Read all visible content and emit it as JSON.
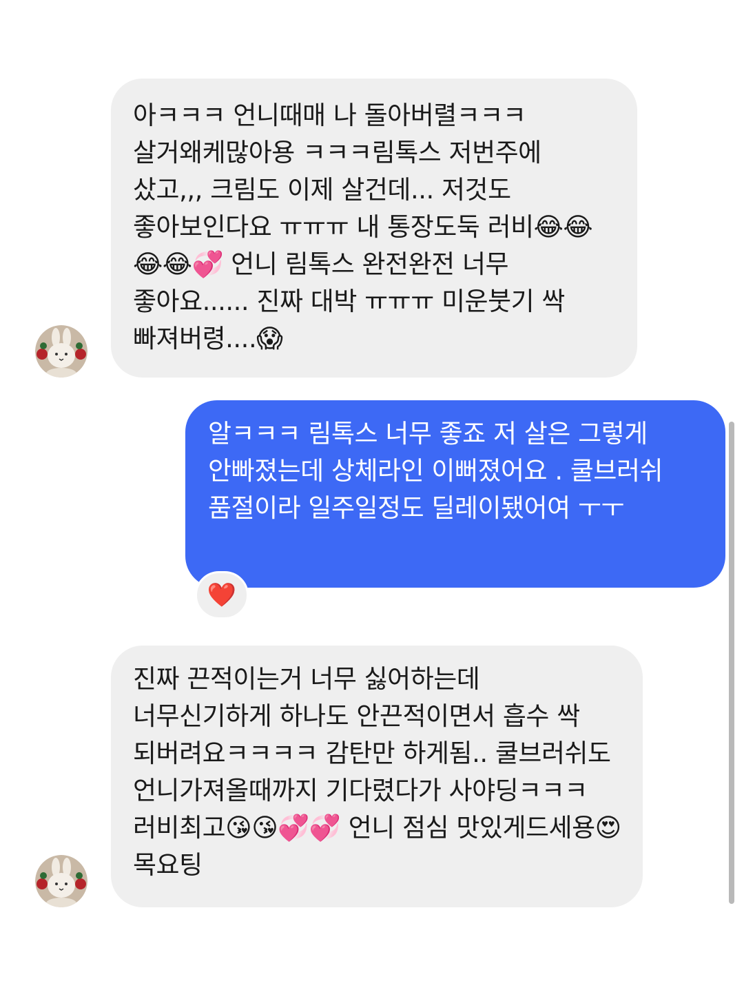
{
  "conversation": {
    "messages": [
      {
        "direction": "incoming",
        "text": "아ㅋㅋㅋ 언니때매 나 돌아버렬ㅋㅋㅋ 살거왜케많아용 ㅋㅋㅋ림톡스 저번주에 샀고,,, 크림도 이제 살건데... 저것도 좋아보인다요 ㅠㅠㅠ 내 통장도둑 러비😂😂😂😂💞 언니 림톡스 완전완전 너무 좋아요...... 진짜 대박 ㅠㅠㅠ 미운붓기 싹 빠져버령....😱"
      },
      {
        "direction": "outgoing",
        "text": "알ㅋㅋㅋ 림톡스 너무 좋죠 저 살은 그렇게 안빠졌는데 상체라인 이뻐졌어요 . 쿨브러쉬 품절이라 일주일정도 딜레이됐어여 ㅜㅜ",
        "reaction": "❤️"
      },
      {
        "direction": "incoming",
        "text": "진짜 끈적이는거 너무 싫어하는데 너무신기하게 하나도 안끈적이면서 흡수 싹 되버려요ㅋㅋㅋㅋ 감탄만 하게됨.. 쿨브러쉬도 언니가져올때까지 기다렸다가 사야딩ㅋㅋㅋ 러비최고😘😘💞💞 언니 점심 맛있게드세용😍 목요팅"
      }
    ],
    "avatar_icon": "bunny-avatar-icon"
  },
  "colors": {
    "incoming_bubble": "#efefef",
    "outgoing_bubble": "#3d69f5",
    "incoming_text": "#1a1a1a",
    "outgoing_text": "#ffffff"
  }
}
